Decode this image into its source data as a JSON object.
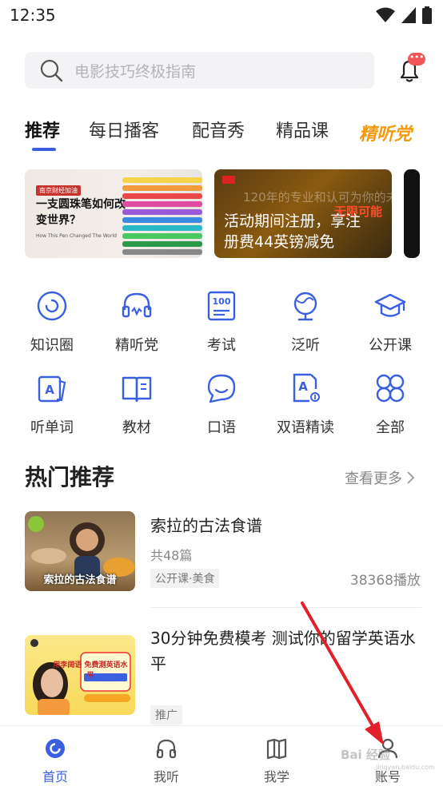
{
  "status_bar": {
    "time": "12:35"
  },
  "search": {
    "placeholder": "电影技巧终极指南"
  },
  "notification": {
    "badge": "•••"
  },
  "tabs": [
    {
      "label": "推荐",
      "active": true
    },
    {
      "label": "每日播客"
    },
    {
      "label": "配音秀"
    },
    {
      "label": "精品课"
    },
    {
      "label": "精听党"
    }
  ],
  "banners": [
    {
      "tag": "南京财经加油",
      "title": "一支圆珠笔如何改变世界？",
      "subtitle": "How This Pen Changed The World"
    },
    {
      "background_text": "120年的专业和认可为你的未来创造",
      "accent_text": "无限可能",
      "title_line1": "活动期间注册，享注",
      "title_line2": "册费44英镑减免"
    }
  ],
  "features": [
    {
      "label": "知识圈",
      "icon": "knowledge-circle-icon"
    },
    {
      "label": "精听党",
      "icon": "headset-icon"
    },
    {
      "label": "考试",
      "icon": "exam-100-icon"
    },
    {
      "label": "泛听",
      "icon": "globe-icon"
    },
    {
      "label": "公开课",
      "icon": "graduation-cap-icon"
    },
    {
      "label": "听单词",
      "icon": "word-card-icon"
    },
    {
      "label": "教材",
      "icon": "book-icon"
    },
    {
      "label": "口语",
      "icon": "chat-bubble-icon"
    },
    {
      "label": "双语精读",
      "icon": "bilingual-icon"
    },
    {
      "label": "全部",
      "icon": "all-grid-icon"
    }
  ],
  "hot_section": {
    "title": "热门推荐",
    "see_more": "查看更多"
  },
  "recommendations": [
    {
      "title": "索拉的古法食谱",
      "count": "共48篇",
      "tag": "公开课·美食",
      "plays": "38368播放",
      "thumb_caption": "索拉的古法食谱"
    },
    {
      "title": "30分钟免费模考 测试你的留学英语水平",
      "tag": "推广",
      "thumb_caption": "用李阔语 免费测英语水平"
    }
  ],
  "bottom_nav": [
    {
      "label": "首页",
      "active": true,
      "icon": "home-icon"
    },
    {
      "label": "我听",
      "icon": "headphones-icon"
    },
    {
      "label": "我学",
      "icon": "open-book-icon"
    },
    {
      "label": "账号",
      "icon": "user-icon"
    }
  ],
  "watermark": {
    "text": "Bai 经验",
    "sub": "jingyan.baidu.com"
  },
  "colors": {
    "accent": "#3a5fe0",
    "promo": "#f29a10",
    "badge": "#f25555",
    "arrow": "#e0202a"
  }
}
